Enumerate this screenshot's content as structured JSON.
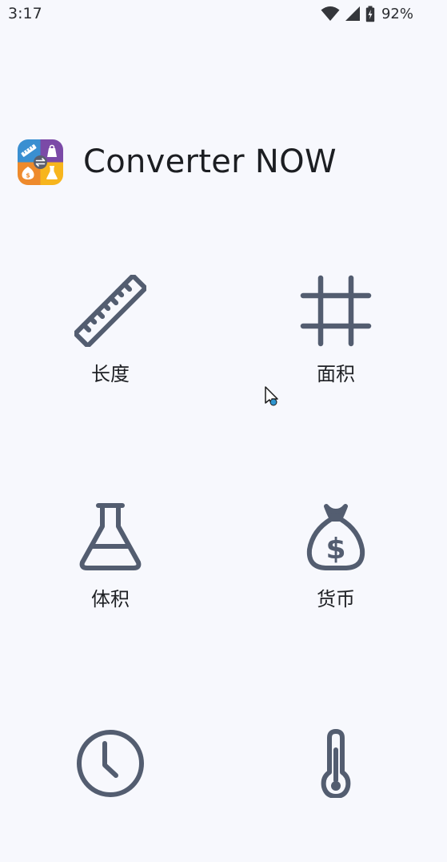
{
  "status_bar": {
    "time": "3:17",
    "battery": "92%",
    "icons": [
      "wifi-icon",
      "cellular-signal-icon",
      "battery-charging-icon"
    ]
  },
  "app": {
    "title": "Converter NOW",
    "logo_icon": "app-logo-icon"
  },
  "colors": {
    "background": "#f7f8fd",
    "icon_stroke": "#535d70",
    "text": "#1d1f24",
    "logo_blue": "#3a8fd1",
    "logo_purple": "#7b4aa7",
    "logo_orange": "#ee8a2c",
    "logo_yellow": "#f7b51d"
  },
  "categories": [
    {
      "label": "长度",
      "icon": "ruler-icon"
    },
    {
      "label": "面积",
      "icon": "crop-square-icon"
    },
    {
      "label": "体积",
      "icon": "flask-icon"
    },
    {
      "label": "货币",
      "icon": "money-bag-icon"
    },
    {
      "label": "",
      "icon": "clock-icon"
    },
    {
      "label": "",
      "icon": "thermometer-icon"
    }
  ]
}
